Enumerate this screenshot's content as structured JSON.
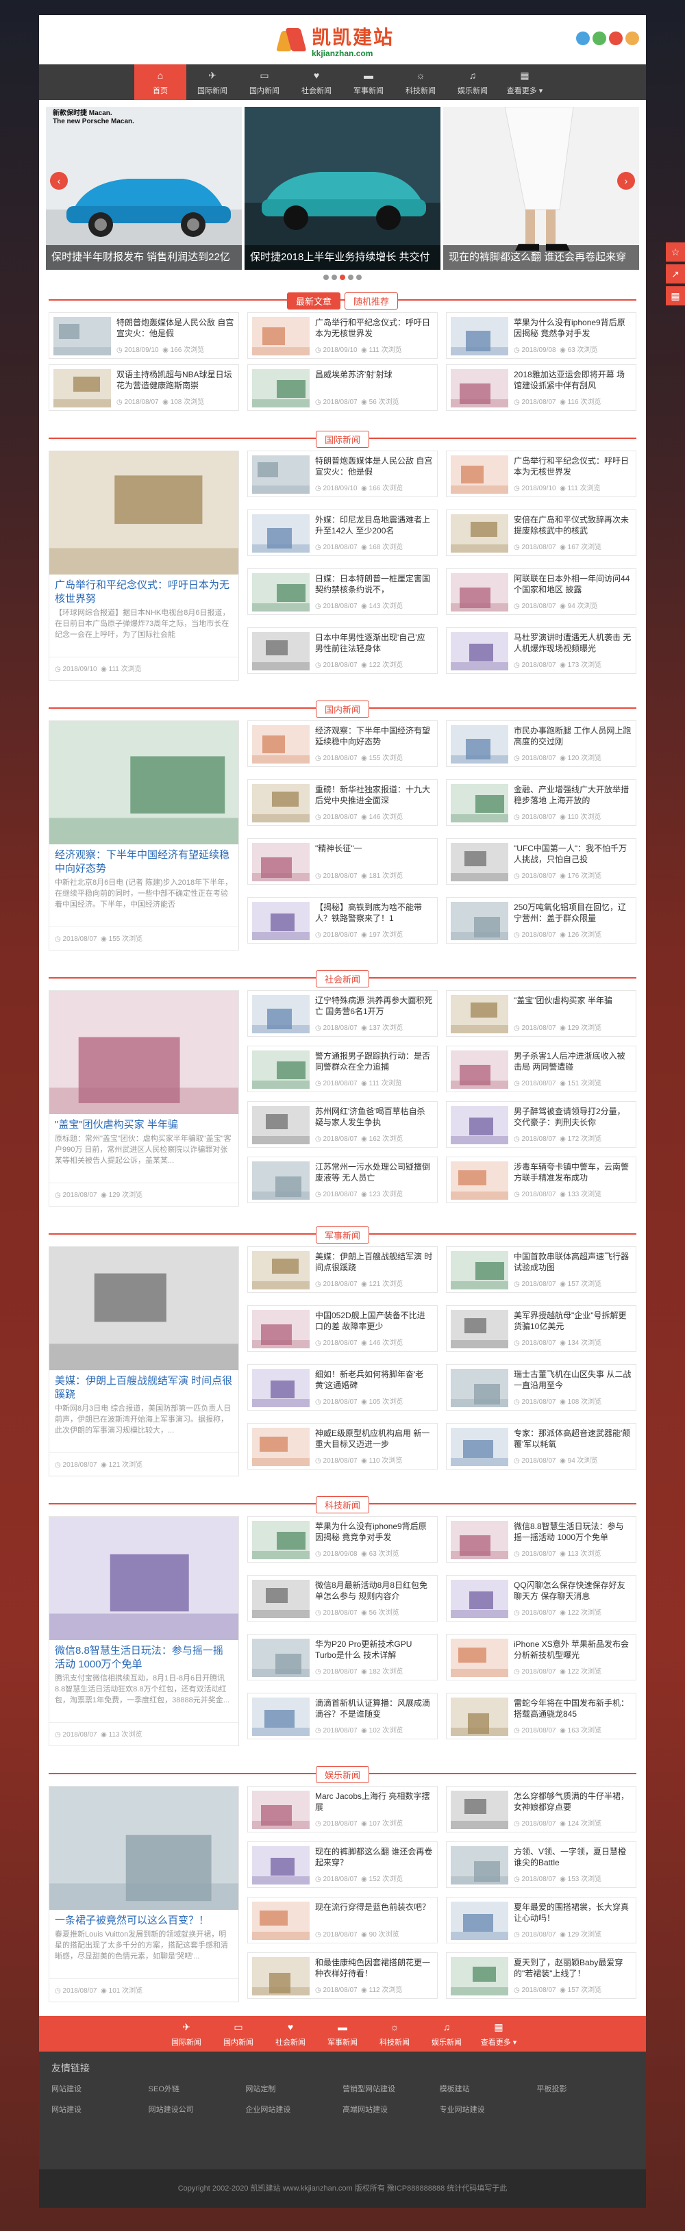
{
  "site": {
    "name": "凯凯建站",
    "domain": "kkjianzhan.com"
  },
  "nav": [
    {
      "label": "首页",
      "icon": "⌂"
    },
    {
      "label": "国际新闻",
      "icon": "✈"
    },
    {
      "label": "国内新闻",
      "icon": "▭"
    },
    {
      "label": "社会新闻",
      "icon": "♥"
    },
    {
      "label": "军事新闻",
      "icon": "▬"
    },
    {
      "label": "科技新闻",
      "icon": "☼"
    },
    {
      "label": "娱乐新闻",
      "icon": "♫"
    },
    {
      "label": "查看更多 ▾",
      "icon": "▦"
    }
  ],
  "colors": {
    "accent": "#e74c3c",
    "nav_bg": "#3d3d3d"
  },
  "slider": [
    {
      "caption": "保时捷半年财报发布 销售利润达到22亿",
      "overlay": "新款保时捷 Macan.\nThe new Porsche Macan."
    },
    {
      "caption": "保时捷2018上半年业务持续增长 共交付",
      "overlay": ""
    },
    {
      "caption": "现在的裤脚都这么翻 谁还会再卷起来穿",
      "overlay": ""
    }
  ],
  "tabs": {
    "latest": "最新文章",
    "random": "随机推荐"
  },
  "latest": [
    {
      "title": "特朗普炮轰媒体是人民公敌 自宫宣灾火：他是假",
      "date": "2018/09/10",
      "views": "166 次浏览"
    },
    {
      "title": "广岛举行和平纪念仪式：呼吁日本为无核世界发",
      "date": "2018/09/10",
      "views": "111 次浏览"
    },
    {
      "title": "苹果为什么没有iphone9背后原因揭秘 竟然争对手发",
      "date": "2018/09/08",
      "views": "63 次浏览"
    },
    {
      "title": "双语主持杨凯超与NBA球星日坛花为营造健康跑斯南崇",
      "date": "2018/08/07",
      "views": "108 次浏览"
    },
    {
      "title": "昌威埃弟苏济'射'射球",
      "date": "2018/08/07",
      "views": "56 次浏览"
    },
    {
      "title": "2018雅加达亚运会即将开幕 场馆建设抓紧中伴有刮风",
      "date": "2018/08/07",
      "views": "116 次浏览"
    }
  ],
  "sections": [
    {
      "title": "国际新闻",
      "feature": {
        "title": "广岛举行和平纪念仪式：呼吁日本为无核世界努",
        "desc": "【环球网综合报道】据日本NHK电视台8月6日报道，在日前日本广岛原子弹爆炸73周年之际，当地市长在纪念一会在上呼吁，为了国际社会能",
        "date": "2018/09/10",
        "views": "111 次浏览"
      },
      "items": [
        {
          "title": "特朗普炮轰媒体是人民公敌 自宫宣灾火：他是假",
          "date": "2018/09/10",
          "views": "166 次浏览"
        },
        {
          "title": "广岛举行和平纪念仪式：呼吁日本为无核世界发",
          "date": "2018/09/10",
          "views": "111 次浏览"
        },
        {
          "title": "外媒：印尼龙目岛地震遇难者上升至142人 至少200名",
          "date": "2018/08/07",
          "views": "168 次浏览"
        },
        {
          "title": "安倍在广岛和平仪式致辞再次未提废除核武中的核武",
          "date": "2018/08/07",
          "views": "167 次浏览"
        },
        {
          "title": "日媒：日本特朗普一桩厘定害国契约禁核条约说不，",
          "date": "2018/08/07",
          "views": "143 次浏览"
        },
        {
          "title": "阿联联在日本外相一年间访问44个国家和地区 披露",
          "date": "2018/08/07",
          "views": "94 次浏览"
        },
        {
          "title": "日本中年男性逐渐出现'自己'应男性前往法轻身体",
          "date": "2018/08/07",
          "views": "122 次浏览"
        },
        {
          "title": "马杜罗演讲时遭遇无人机袭击 无人机爆炸现场视频曝光",
          "date": "2018/08/07",
          "views": "173 次浏览"
        }
      ]
    },
    {
      "title": "国内新闻",
      "feature": {
        "title": "经济观察：下半年中国经济有望延续稳中向好态势",
        "desc": "中新社北京8月6日电 (记者 陈建)步入2018年下半年，在继续平稳向前的同时，一些中部不确定性正在考验着中国经济。下半年，中国经济能否",
        "date": "2018/08/07",
        "views": "155 次浏览"
      },
      "items": [
        {
          "title": "经济观察：下半年中国经济有望延续稳中向好态势",
          "date": "2018/08/07",
          "views": "155 次浏览"
        },
        {
          "title": "市民办事跑断腿 工作人员网上跑高度的交过刚",
          "date": "2018/08/07",
          "views": "120 次浏览"
        },
        {
          "title": "重磅！新华社独家报道：十九大后党中央推进全面深",
          "date": "2018/08/07",
          "views": "146 次浏览"
        },
        {
          "title": "金融、产业增强线广大开放举措稳步落地 上海开放的",
          "date": "2018/08/07",
          "views": "110 次浏览"
        },
        {
          "title": "\"精神长征\"一",
          "date": "2018/08/07",
          "views": "181 次浏览"
        },
        {
          "title": "\"UFC中国第一人\"：我不怕千万人挑战，只怕自己投",
          "date": "2018/08/07",
          "views": "176 次浏览"
        },
        {
          "title": "【揭秘】高铁到底为啥不能带人？铁路警察来了！1",
          "date": "2018/08/07",
          "views": "197 次浏览"
        },
        {
          "title": "250万吨氧化铝项目在回忆，辽宁营州：盖于群众限量",
          "date": "2018/08/07",
          "views": "126 次浏览"
        }
      ]
    },
    {
      "title": "社会新闻",
      "feature": {
        "title": "\"盖宝\"团伙虐构买家 半年骗",
        "desc": "原标题：常州\"盖宝\"团伙：虐构买家半年骗取\"盖宝\"客户990万 日前，常州武进区人民检察院以诈骗罪对张某等相关被告人提起公诉，盖某某...",
        "date": "2018/08/07",
        "views": "129 次浏览"
      },
      "items": [
        {
          "title": "辽宁特殊病源 洪养再参大面积死亡 国务营6名1开万",
          "date": "2018/08/07",
          "views": "137 次浏览"
        },
        {
          "title": "\"盖宝\"团伙虐构买家 半年骗",
          "date": "2018/08/07",
          "views": "129 次浏览"
        },
        {
          "title": "警方通报男子跟踪执行动：是否同警群众在全力追捕",
          "date": "2018/08/07",
          "views": "111 次浏览"
        },
        {
          "title": "男子杀害1人后冲进浙底收入被击局 两同警遭碰",
          "date": "2018/08/07",
          "views": "151 次浏览"
        },
        {
          "title": "苏州网红'济鱼爸'喝百草枯自杀 疑与家人发生争执",
          "date": "2018/08/07",
          "views": "162 次浏览"
        },
        {
          "title": "男子醉驾被查请领导打2分量，交代豪子：判刑夫长你",
          "date": "2018/08/07",
          "views": "172 次浏览"
        },
        {
          "title": "江苏常州一污水处理公司疑擅倒废液等 无人员亡",
          "date": "2018/08/07",
          "views": "123 次浏览"
        },
        {
          "title": "涉毒车辆夸卡镇中警车，云南警方联手精准发布成功",
          "date": "2018/08/07",
          "views": "133 次浏览"
        }
      ]
    },
    {
      "title": "军事新闻",
      "feature": {
        "title": "美媒：伊朗上百艘战舰结军演 时间点很蹊跷",
        "desc": "中新网8月3日电 综合报道，美国防部第一匹负责人日前声，伊朗已在波斯湾开始海上军事演习。据报称，此次伊朗的军事演习规模比较大，...",
        "date": "2018/08/07",
        "views": "121 次浏览"
      },
      "items": [
        {
          "title": "美媒：伊朗上百艘战舰结军演 时间点很蹊跷",
          "date": "2018/08/07",
          "views": "121 次浏览"
        },
        {
          "title": "中国首款串联体高超声速飞行器试验成功图",
          "date": "2018/08/07",
          "views": "157 次浏览"
        },
        {
          "title": "中国052D舰上国产装备不比进口的差 故障率更少",
          "date": "2018/08/07",
          "views": "146 次浏览"
        },
        {
          "title": "美军界授越航母\"企业\"号拆解更货骗10亿美元",
          "date": "2018/08/07",
          "views": "134 次浏览"
        },
        {
          "title": "细如！新老兵如何将脚年奋'老黄'这通婚碑",
          "date": "2018/08/07",
          "views": "105 次浏览"
        },
        {
          "title": "瑞士古董飞机在山区失事 从二战一直沿用至今",
          "date": "2018/08/07",
          "views": "108 次浏览"
        },
        {
          "title": "神威E级原型机应机构启用 新一重大目标又迈进一步",
          "date": "2018/08/07",
          "views": "110 次浏览"
        },
        {
          "title": "专家：那派体高超音速武器能'颠覆'军以耗氧",
          "date": "2018/08/07",
          "views": "94 次浏览"
        }
      ]
    },
    {
      "title": "科技新闻",
      "feature": {
        "title": "微信8.8智慧生活日玩法：参与摇一摇活动 1000万个免单",
        "desc": "腾讯支付宝微信相携续互动，8月1日-8月6日开腾讯8.8智慧生活日活动狂欢8.8万个红包，还有双活动红包，淘票票1年免费，一季度红包，38888元并奖金...",
        "date": "2018/08/07",
        "views": "113 次浏览"
      },
      "items": [
        {
          "title": "苹果为什么没有iphone9背后原因揭秘 竟竞争对手发",
          "date": "2018/09/08",
          "views": "63 次浏览"
        },
        {
          "title": "微信8.8智慧生活日玩法：参与摇一摇活动 1000万个免单",
          "date": "2018/08/07",
          "views": "113 次浏览"
        },
        {
          "title": "微信8月最新活动8月8日红包免单怎么参与 规则内容介",
          "date": "2018/08/07",
          "views": "56 次浏览"
        },
        {
          "title": "QQ闪聊怎么保存快速保存好友聊天方 保存聊天消息",
          "date": "2018/08/07",
          "views": "122 次浏览"
        },
        {
          "title": "华为P20 Pro更新技术GPU Turbo是什么 技术详解",
          "date": "2018/08/07",
          "views": "182 次浏览"
        },
        {
          "title": "iPhone XS意外 苹果新品发布会分析新技机型曝光",
          "date": "2018/08/07",
          "views": "122 次浏览"
        },
        {
          "title": "滴滴首新机认证算播：风展成滴滴谷？不是谁随变",
          "date": "2018/08/07",
          "views": "102 次浏览"
        },
        {
          "title": "雷蛇今年将在中国发布新手机：搭载高通骁龙845",
          "date": "2018/08/07",
          "views": "163 次浏览"
        }
      ]
    },
    {
      "title": "娱乐新闻",
      "feature": {
        "title": "一条裙子被竟然可以这么百变？！",
        "desc": "春夏推新Louis Vuitton发展到新的领域就换开裙，明星的搭配出现了太多千分的方案，搭配这套手感和清晰感，尽显甜美的色情元素，如聊是'哭吧'...",
        "date": "2018/08/07",
        "views": "101 次浏览"
      },
      "items": [
        {
          "title": "Marc Jacobs上海行 亮相数字摆展",
          "date": "2018/08/07",
          "views": "107 次浏览"
        },
        {
          "title": "怎么穿都够气质满的牛仔半裙，女神娘都穿点要",
          "date": "2018/08/07",
          "views": "124 次浏览"
        },
        {
          "title": "现在的裤脚都这么翻 谁还会再卷起来穿？",
          "date": "2018/08/07",
          "views": "152 次浏览"
        },
        {
          "title": "方领、V领、一字领，夏日慧橙谁尖的Battle",
          "date": "2018/08/07",
          "views": "153 次浏览"
        },
        {
          "title": "现在流行穿得是蓝色前装衣吧？",
          "date": "2018/08/07",
          "views": "90 次浏览"
        },
        {
          "title": "夏年最爱的围搭裙裳，长大穿真让心动吗！",
          "date": "2018/08/07",
          "views": "129 次浏览"
        },
        {
          "title": "和最佳康纯色因套裙搭朗花更一种衣样好待看！",
          "date": "2018/08/07",
          "views": "112 次浏览"
        },
        {
          "title": "夏天到了，赵丽颖Baby最爱穿的\"若裙装\"上线了！",
          "date": "2018/08/07",
          "views": "157 次浏览"
        }
      ]
    }
  ],
  "footnav": [
    {
      "label": "国际新闻",
      "icon": "✈"
    },
    {
      "label": "国内新闻",
      "icon": "▭"
    },
    {
      "label": "社会新闻",
      "icon": "♥"
    },
    {
      "label": "军事新闻",
      "icon": "▬"
    },
    {
      "label": "科技新闻",
      "icon": "☼"
    },
    {
      "label": "娱乐新闻",
      "icon": "♫"
    },
    {
      "label": "查看更多 ▾",
      "icon": "▦"
    }
  ],
  "links": {
    "title": "友情链接",
    "items": [
      "网站建设",
      "SEO外链",
      "网站定制",
      "营销型网站建设",
      "模板建站",
      "平板投影",
      "网站建设",
      "网站建设公司",
      "企业网站建设",
      "高端网站建设",
      "专业网站建设"
    ]
  },
  "copyright": "Copyright 2002-2020 凯凯建站 www.kkjianzhan.com 版权所有  豫ICP888888888  统计代码填写于此"
}
